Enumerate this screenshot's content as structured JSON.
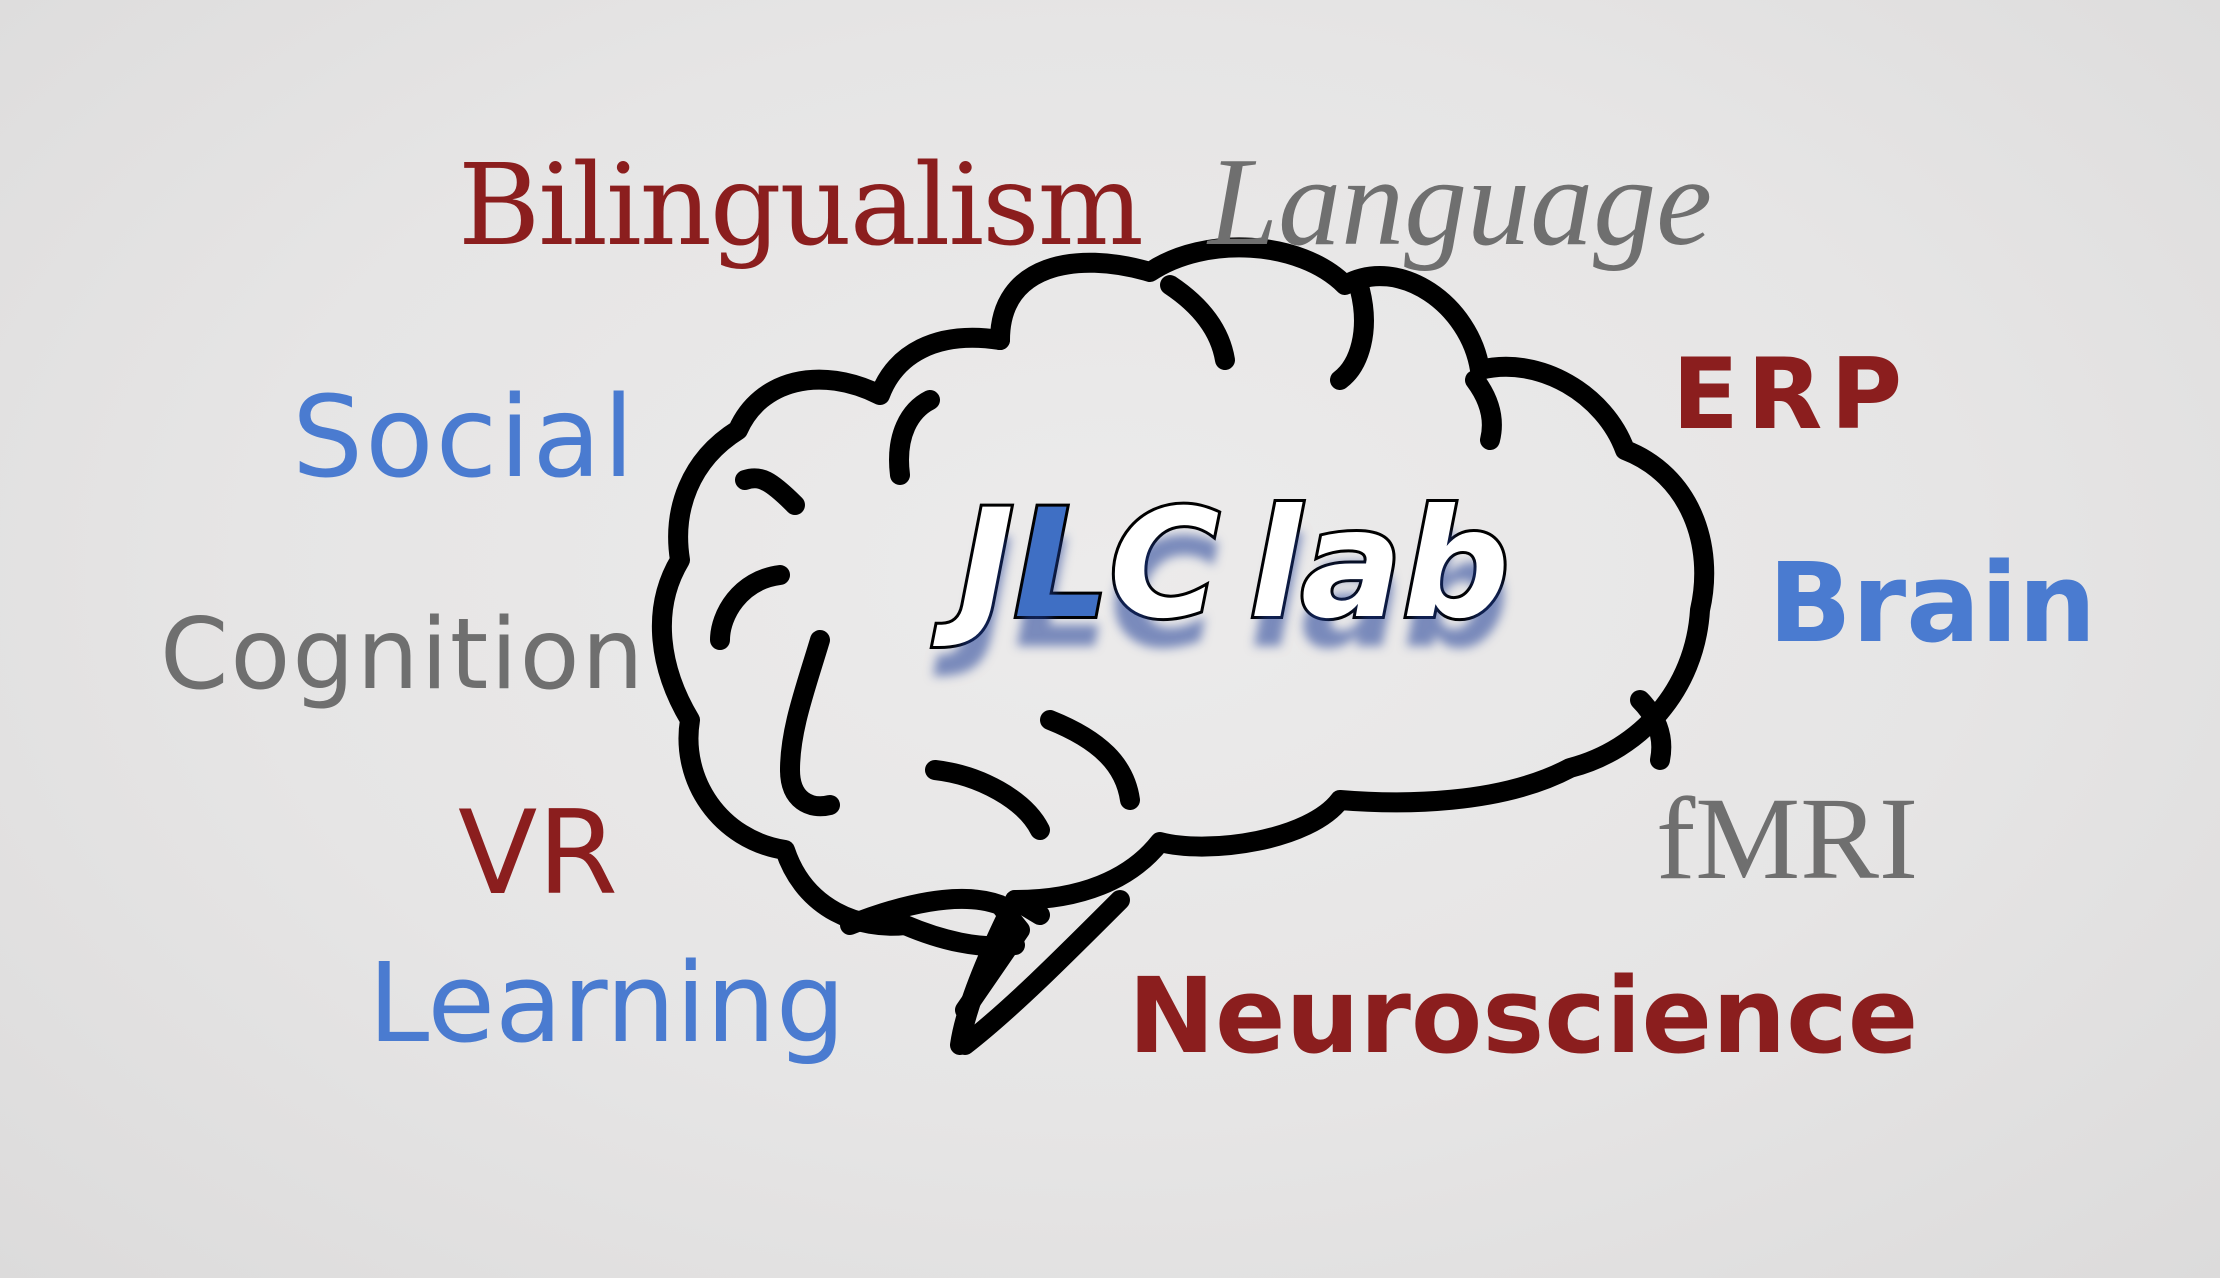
{
  "logo": {
    "part_jl_j": "J",
    "part_l": "L",
    "part_c": "C",
    "part_lab": "lab",
    "fill_color": "#ffffff",
    "accent_l_color": "#3f6fc4",
    "shadow_color": "#2b4fa8"
  },
  "keywords": {
    "bilingualism": "Bilingualism",
    "language": "Language",
    "social": "Social",
    "erp": "ERP",
    "brain": "Brain",
    "cognition": "Cognition",
    "vr": "VR",
    "fmri": "fMRI",
    "learning": "Learning",
    "neuroscience": "Neuroscience"
  },
  "colors": {
    "dark_red": "#8b1e1e",
    "gray": "#6f6f6f",
    "blue": "#4a7bd0",
    "outline": "#000000"
  },
  "icons": {
    "brain_outline": "brain-outline-icon"
  }
}
